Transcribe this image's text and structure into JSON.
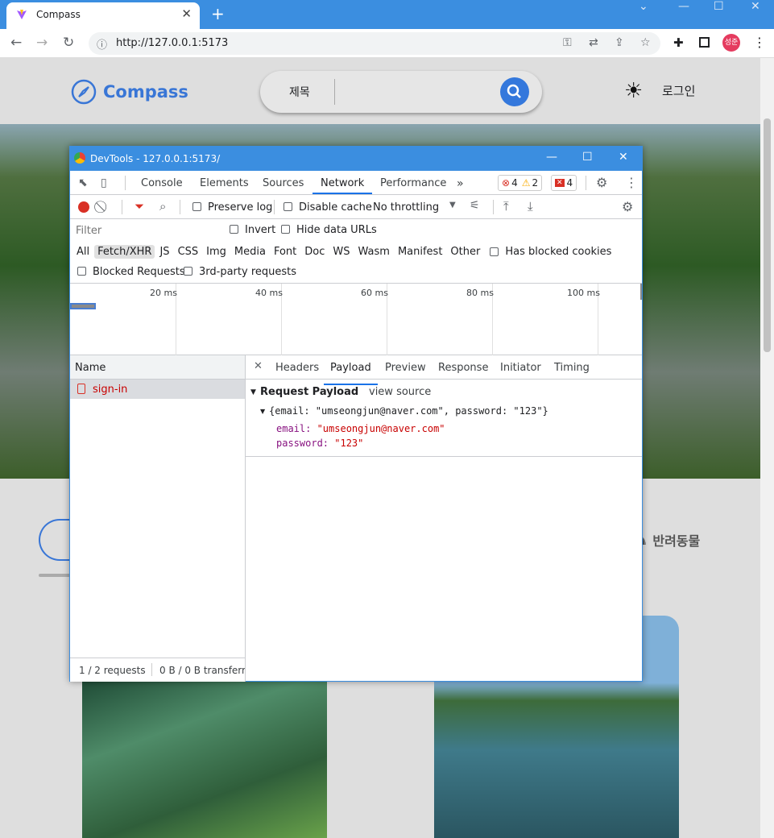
{
  "browser": {
    "tab_title": "Compass",
    "url": "http://127.0.0.1:5173",
    "profile_initials": "성준"
  },
  "site": {
    "logo_text": "Compass",
    "search_category": "제목",
    "login_label": "로그인",
    "category_pet_label": "반려동물"
  },
  "devtools": {
    "window_title": "DevTools - 127.0.0.1:5173/",
    "tabs": [
      "Console",
      "Elements",
      "Sources",
      "Network",
      "Performance"
    ],
    "active_tab": "Network",
    "errors_count": "4",
    "warnings_count": "2",
    "issues_count": "4",
    "toolbar": {
      "preserve_log": "Preserve log",
      "disable_cache": "Disable cache",
      "throttling": "No throttling"
    },
    "filter": {
      "placeholder": "Filter",
      "invert": "Invert",
      "hide_data_urls": "Hide data URLs",
      "types": [
        "All",
        "Fetch/XHR",
        "JS",
        "CSS",
        "Img",
        "Media",
        "Font",
        "Doc",
        "WS",
        "Wasm",
        "Manifest",
        "Other"
      ],
      "active_type": "Fetch/XHR",
      "has_blocked_cookies": "Has blocked cookies",
      "blocked_requests": "Blocked Requests",
      "third_party": "3rd-party requests"
    },
    "timeline_ticks": [
      "20 ms",
      "40 ms",
      "60 ms",
      "80 ms",
      "100 ms"
    ],
    "requests": {
      "column_name": "Name",
      "items": [
        "sign-in"
      ],
      "summary": "1 / 2 requests",
      "transfer": "0 B / 0 B transferr"
    },
    "detail": {
      "tabs": [
        "Headers",
        "Payload",
        "Preview",
        "Response",
        "Initiator",
        "Timing"
      ],
      "active_tab": "Payload",
      "section_title": "Request Payload",
      "view_source": "view source",
      "object_summary": "{email: \"umseongjun@naver.com\", password: \"123\"}",
      "fields": [
        {
          "key": "email",
          "value": "\"umseongjun@naver.com\""
        },
        {
          "key": "password",
          "value": "\"123\""
        }
      ]
    }
  },
  "colors": {
    "chrome_blue": "#3b8ee0",
    "accent": "#3976d6",
    "error_red": "#d93025",
    "warning_yellow": "#f9ab00"
  }
}
